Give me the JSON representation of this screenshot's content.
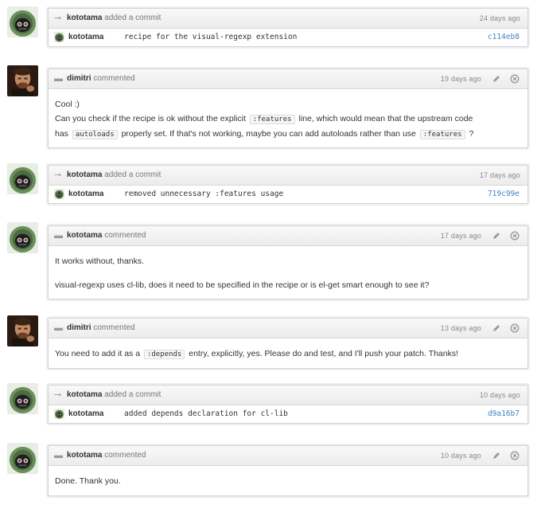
{
  "events": {
    "e1": {
      "author": "kototama",
      "action": "added a commit",
      "time": "24 days ago",
      "commit_author": "kototama",
      "message": "recipe for the visual-regexp extension",
      "sha": "c114eb8"
    },
    "e2": {
      "author": "dimitri",
      "action": "commented",
      "time": "19 days ago",
      "line1": "Cool :)",
      "line2a": "Can you check if the recipe is ok without the explicit",
      "code1": ":features",
      "line2b": "line, which would mean that the upstream code",
      "line3a": "has",
      "code2": "autoloads",
      "line3b": "properly set. If that's not working, maybe you can add autoloads rather than use",
      "code3": ":features",
      "line3c": "?"
    },
    "e3": {
      "author": "kototama",
      "action": "added a commit",
      "time": "17 days ago",
      "commit_author": "kototama",
      "message": "removed unnecessary :features usage",
      "sha": "719c99e"
    },
    "e4": {
      "author": "kototama",
      "action": "commented",
      "time": "17 days ago",
      "line1": "It works without, thanks.",
      "line2": "visual-regexp uses cl-lib, does it need to be specified in the recipe or is el-get smart enough to see it?"
    },
    "e5": {
      "author": "dimitri",
      "action": "commented",
      "time": "13 days ago",
      "line1a": "You need to add it as a",
      "code1": ":depends",
      "line1b": "entry, explicitly, yes. Please do and test, and I'll push your patch. Thanks!"
    },
    "e6": {
      "author": "kototama",
      "action": "added a commit",
      "time": "10 days ago",
      "commit_author": "kototama",
      "message": "added depends declaration for cl-lib",
      "sha": "d9a16b7"
    },
    "e7": {
      "author": "kototama",
      "action": "commented",
      "time": "10 days ago",
      "line1": "Done. Thank you."
    }
  },
  "icons": {
    "commit": "commit-icon",
    "comment": "comment-icon",
    "edit": "pencil-icon",
    "delete": "close-circle-icon"
  },
  "colors": {
    "sha": "#4183c4",
    "header_bg": "#f0f0f0",
    "border": "#d4d4d4"
  }
}
